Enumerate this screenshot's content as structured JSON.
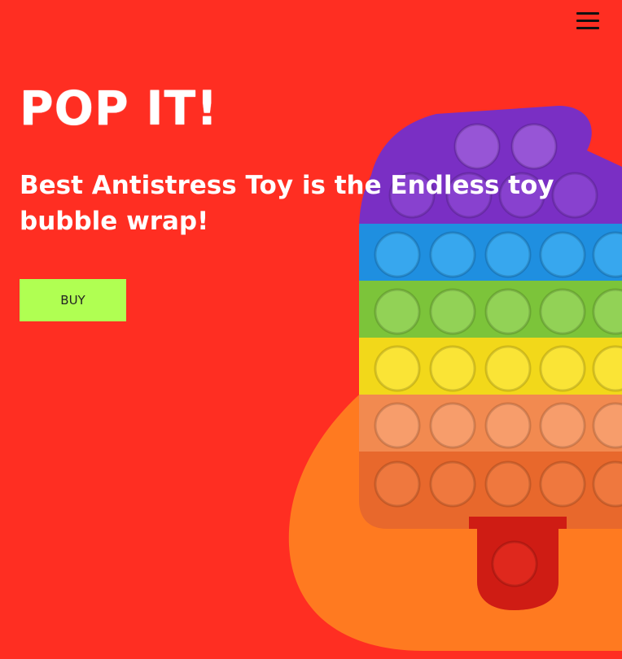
{
  "nav": {
    "menu_icon": "hamburger-menu-icon"
  },
  "hero": {
    "logo": "POP IT!",
    "headline": "Best Antistress Toy is the Endless toy bubble wrap!",
    "buy_label": "BUY"
  },
  "image": {
    "subject": "popsicle-pop-it-toy"
  },
  "colors": {
    "background": "#ff2e22",
    "blob": "#ff7a20",
    "button": "#b0ff52",
    "text": "#ffffff"
  }
}
